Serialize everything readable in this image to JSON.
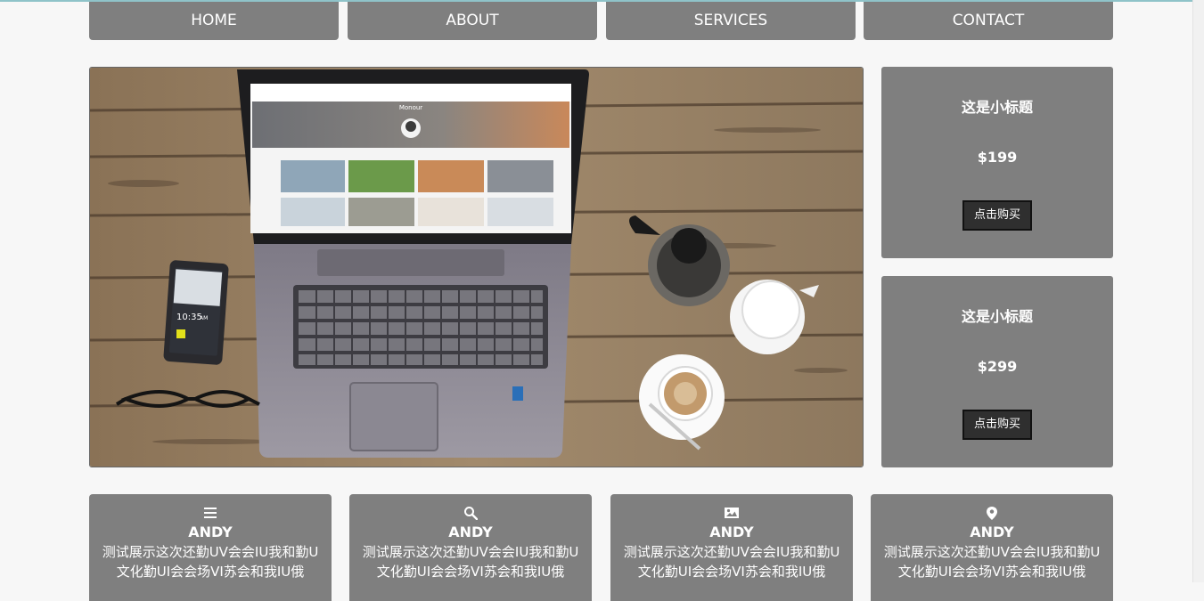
{
  "nav": {
    "items": [
      "HOME",
      "ABOUT",
      "SERVICES",
      "CONTACT"
    ]
  },
  "cards": [
    {
      "title": "这是小标题",
      "price": "$199",
      "button": "点击购买"
    },
    {
      "title": "这是小标题",
      "price": "$299",
      "button": "点击购买"
    }
  ],
  "features": [
    {
      "icon": "menu-icon",
      "name": "ANDY",
      "desc": "测试展示这次还勤UV会会IU我和勤U文化勤UI会会场VI苏会和我IU俄"
    },
    {
      "icon": "search-icon",
      "name": "ANDY",
      "desc": "测试展示这次还勤UV会会IU我和勤U文化勤UI会会场VI苏会和我IU俄"
    },
    {
      "icon": "image-icon",
      "name": "ANDY",
      "desc": "测试展示这次还勤UV会会IU我和勤U文化勤UI会会场VI苏会和我IU俄"
    },
    {
      "icon": "map-marker-icon",
      "name": "ANDY",
      "desc": "测试展示这次还勤UV会会IU我和勤U文化勤UI会会场VI苏会和我IU俄"
    }
  ],
  "phone_screen": {
    "time": "10:35",
    "ampm": "AM"
  },
  "laptop_screen": {
    "profile_name": "Monour"
  },
  "colors": {
    "panel": "#7f7f7f",
    "button": "#2f2f2f",
    "page_bg": "#f7f7f7",
    "accent_line": "#8fc3c9"
  }
}
